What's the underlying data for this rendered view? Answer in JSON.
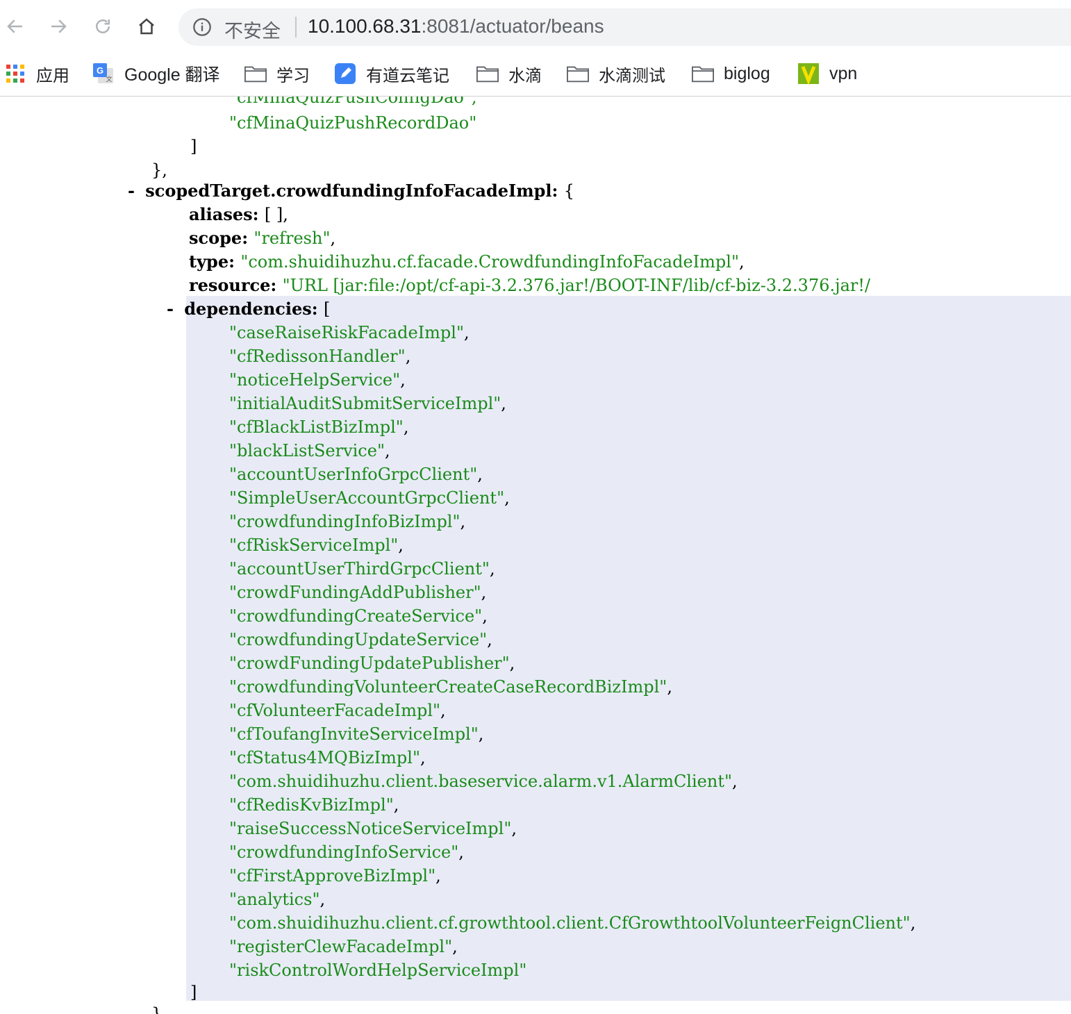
{
  "browser": {
    "security_label": "不安全",
    "url_host": "10.100.68.31",
    "url_rest": ":8081/actuator/beans"
  },
  "bookmarks": [
    {
      "label": "应用",
      "icon": "apps-grid-icon"
    },
    {
      "label": "Google 翻译",
      "icon": "google-translate-icon"
    },
    {
      "label": "学习",
      "icon": "folder-icon"
    },
    {
      "label": "有道云笔记",
      "icon": "youdao-note-icon"
    },
    {
      "label": "水滴",
      "icon": "folder-icon"
    },
    {
      "label": "水滴测试",
      "icon": "folder-icon"
    },
    {
      "label": "biglog",
      "icon": "folder-icon"
    },
    {
      "label": "vpn",
      "icon": "vpn-icon"
    }
  ],
  "json_view": {
    "prev_tail": [
      "\"cfMinaQuizPushConfigDao\",",
      "\"cfMinaQuizPushRecordDao\"",
      "]",
      "},"
    ],
    "bean_key": "scopedTarget.crowdfundingInfoFacadeImpl",
    "aliases_key": "aliases",
    "aliases_value": "[ ],",
    "scope_key": "scope",
    "scope_value": "\"refresh\"",
    "type_key": "type",
    "type_value": "\"com.shuidihuzhu.cf.facade.CrowdfundingInfoFacadeImpl\"",
    "resource_key": "resource",
    "resource_value": "\"URL [jar:file:/opt/cf-api-3.2.376.jar!/BOOT-INF/lib/cf-biz-3.2.376.jar!/",
    "dependencies_key": "dependencies",
    "dependencies": [
      "caseRaiseRiskFacadeImpl",
      "cfRedissonHandler",
      "noticeHelpService",
      "initialAuditSubmitServiceImpl",
      "cfBlackListBizImpl",
      "blackListService",
      "accountUserInfoGrpcClient",
      "SimpleUserAccountGrpcClient",
      "crowdfundingInfoBizImpl",
      "cfRiskServiceImpl",
      "accountUserThirdGrpcClient",
      "crowdFundingAddPublisher",
      "crowdfundingCreateService",
      "crowdfundingUpdateService",
      "crowdFundingUpdatePublisher",
      "crowdfundingVolunteerCreateCaseRecordBizImpl",
      "cfVolunteerFacadeImpl",
      "cfToufangInviteServiceImpl",
      "cfStatus4MQBizImpl",
      "com.shuidihuzhu.client.baseservice.alarm.v1.AlarmClient",
      "cfRedisKvBizImpl",
      "raiseSuccessNoticeServiceImpl",
      "crowdfundingInfoService",
      "cfFirstApproveBizImpl",
      "analytics",
      "com.shuidihuzhu.client.cf.growthtool.client.CfGrowthtoolVolunteerFeignClient",
      "registerClewFacadeImpl",
      "riskControlWordHelpServiceImpl"
    ],
    "close_bracket": "]",
    "close_brace": "},"
  }
}
